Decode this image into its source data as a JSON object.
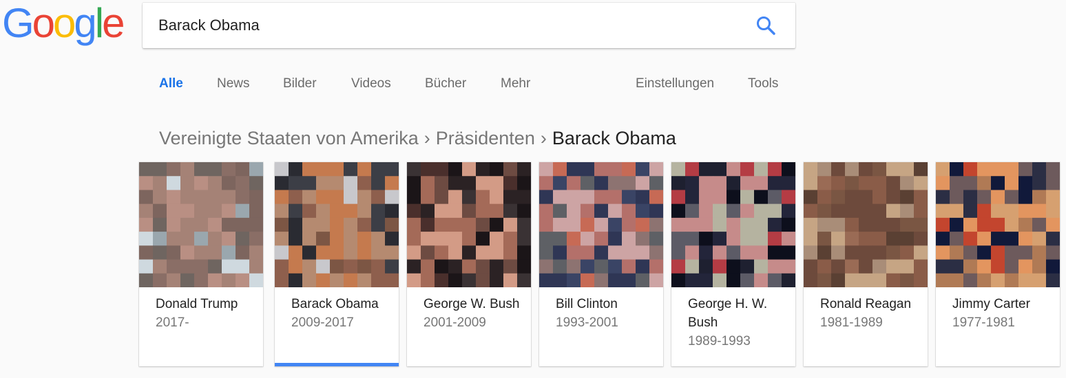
{
  "logo": {
    "letters": [
      "G",
      "o",
      "o",
      "g",
      "l",
      "e"
    ],
    "colors": [
      "#4285F4",
      "#EA4335",
      "#FBBC05",
      "#4285F4",
      "#34A853",
      "#EA4335"
    ]
  },
  "search": {
    "value": "Barack Obama",
    "icon": "search-icon",
    "icon_color": "#4285F4"
  },
  "tabs": [
    {
      "label": "Alle",
      "active": true
    },
    {
      "label": "News"
    },
    {
      "label": "Bilder"
    },
    {
      "label": "Videos"
    },
    {
      "label": "Bücher"
    },
    {
      "label": "Mehr"
    },
    {
      "label": "Einstellungen"
    },
    {
      "label": "Tools"
    }
  ],
  "breadcrumb": {
    "items": [
      "Vereinigte Staaten von Amerika",
      "Präsidenten"
    ],
    "separator": "›",
    "current": "Barack Obama"
  },
  "presidents": [
    {
      "name": "Donald Trump",
      "years": "2017-",
      "palette": [
        "#8a6e66",
        "#a58276",
        "#b98f83",
        "#6f6560",
        "#9aa7ae",
        "#cfd9df",
        "#7d655e"
      ]
    },
    {
      "name": "Barack Obama",
      "years": "2009-2017",
      "selected": true,
      "palette": [
        "#2a2b32",
        "#b58a70",
        "#c57a4e",
        "#7c5644",
        "#c8c8cc",
        "#3c3e46",
        "#8e5f4d"
      ]
    },
    {
      "name": "George W. Bush",
      "years": "2001-2009",
      "palette": [
        "#2b2224",
        "#a46a58",
        "#d39b86",
        "#4a2f2c",
        "#1b1518",
        "#6d4b42",
        "#3a3234"
      ]
    },
    {
      "name": "Bill Clinton",
      "years": "1993-2001",
      "palette": [
        "#c76a55",
        "#cda4a4",
        "#b4706a",
        "#5e6065",
        "#3a4465",
        "#2f3655",
        "#8d7371"
      ]
    },
    {
      "name": "George H. W. Bush",
      "years": "1989-1993",
      "palette": [
        "#23253a",
        "#c68b8a",
        "#b5b3a0",
        "#0d0f1c",
        "#b43c44",
        "#5c5b66",
        "#1e2030"
      ]
    },
    {
      "name": "Ronald Reagan",
      "years": "1981-1989",
      "palette": [
        "#a98d78",
        "#6d4a3c",
        "#8a5c48",
        "#9a6b55",
        "#c6a584",
        "#5a4033",
        "#7a5643"
      ]
    },
    {
      "name": "Jimmy Carter",
      "years": "1977-1981",
      "palette": [
        "#b07a55",
        "#e3955f",
        "#c3452e",
        "#2b2e44",
        "#11193a",
        "#d6a070",
        "#6d5a5c"
      ]
    }
  ]
}
